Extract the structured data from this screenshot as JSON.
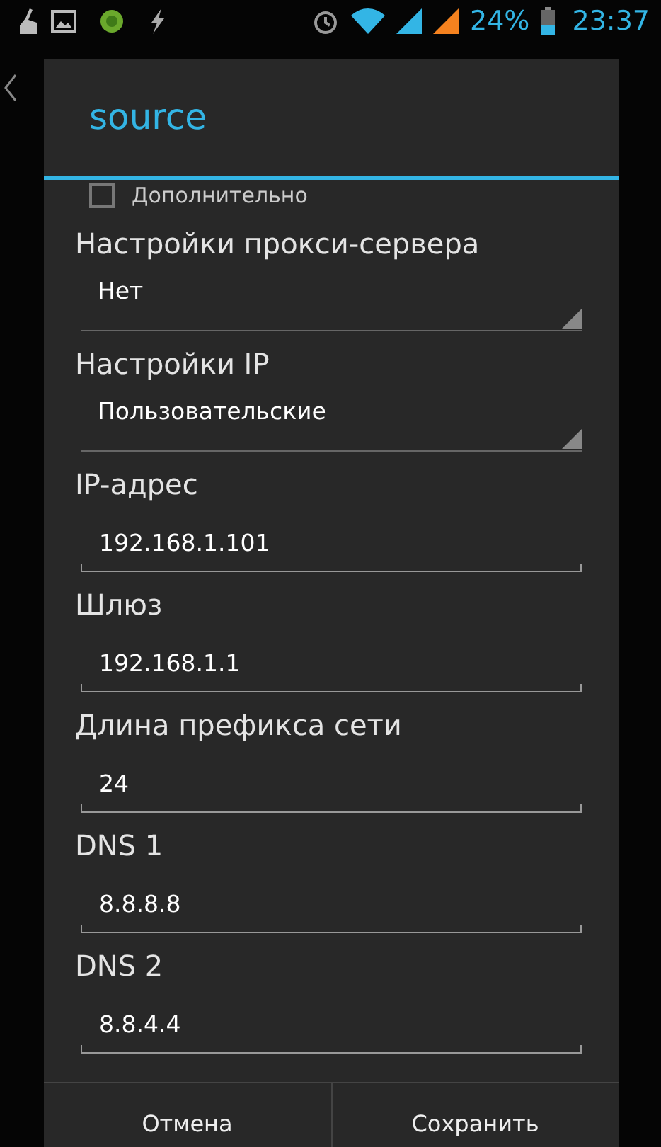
{
  "status_bar": {
    "battery": "24%",
    "time": "23:37"
  },
  "dialog": {
    "title": "source",
    "advanced": {
      "label": "Дополнительно",
      "checked": false
    },
    "fields": [
      {
        "kind": "spinner",
        "label": "Настройки прокси-сервера",
        "value": "Нет"
      },
      {
        "kind": "spinner",
        "label": "Настройки IP",
        "value": "Пользовательские"
      },
      {
        "kind": "text",
        "label": "IP-адрес",
        "value": "192.168.1.101"
      },
      {
        "kind": "text",
        "label": "Шлюз",
        "value": "192.168.1.1"
      },
      {
        "kind": "text",
        "label": "Длина префикса сети",
        "value": "24"
      },
      {
        "kind": "text",
        "label": "DNS 1",
        "value": "8.8.8.8"
      },
      {
        "kind": "text",
        "label": "DNS 2",
        "value": "8.8.4.4"
      }
    ],
    "buttons": [
      "Отмена",
      "Сохранить"
    ]
  }
}
